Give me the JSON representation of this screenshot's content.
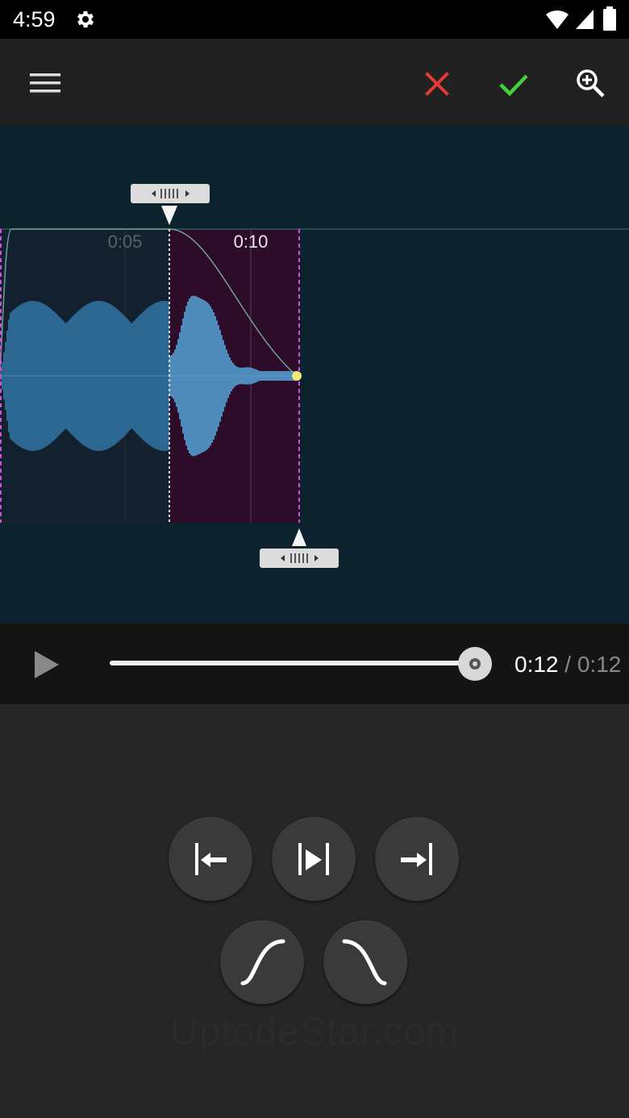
{
  "status_bar": {
    "time": "4:59",
    "icons": [
      "settings-icon",
      "wifi-icon",
      "signal-icon",
      "battery-icon"
    ]
  },
  "toolbar": {
    "menu_icon": "hamburger-menu-icon",
    "cancel_icon": "close-icon",
    "confirm_icon": "check-icon",
    "zoom_icon": "zoom-in-icon",
    "colors": {
      "cancel": "#e53935",
      "confirm": "#43d13a"
    }
  },
  "timeline": {
    "tick_labels": [
      "0:05",
      "0:10"
    ]
  },
  "waveform": {
    "colors": {
      "background": "#0c222d",
      "unselected_region": "#13202e",
      "selected_region": "#2c0c28",
      "wave": "#3b8ec7",
      "wave_selected": "#5db3e8",
      "marker": "#d24fd8",
      "fade_point": "#f1e87a"
    }
  },
  "player": {
    "current_time": "0:12",
    "separator": " / ",
    "total_time": "0:12",
    "progress": 1.0,
    "play_icon": "play-icon"
  },
  "actions": [
    {
      "name": "set-start-button",
      "icon": "arrow-left-to-bar-icon"
    },
    {
      "name": "play-selection-button",
      "icon": "bar-play-bar-icon"
    },
    {
      "name": "set-end-button",
      "icon": "arrow-right-to-bar-icon"
    },
    {
      "name": "fade-in-button",
      "icon": "fade-in-curve-icon"
    },
    {
      "name": "fade-out-button",
      "icon": "fade-out-curve-icon"
    }
  ],
  "watermark": "UptodeStar.com"
}
